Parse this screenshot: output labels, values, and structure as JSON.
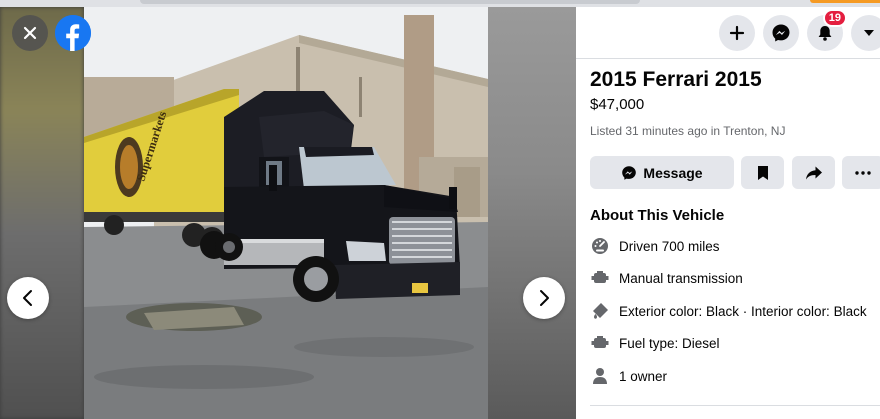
{
  "listing": {
    "title": "2015 Ferrari 2015",
    "price": "$47,000",
    "listed": "Listed 31 minutes ago in Trenton, NJ"
  },
  "topbar": {
    "notification_count": "19",
    "icons": [
      "plus-icon",
      "messenger-icon",
      "bell-icon",
      "caret-down-icon"
    ]
  },
  "actions": {
    "message_label": "Message",
    "icons": [
      "messenger-icon",
      "bookmark-icon",
      "share-icon",
      "more-icon"
    ]
  },
  "about": {
    "title": "About This Vehicle",
    "specs": [
      {
        "icon": "speedometer-icon",
        "text": "Driven 700 miles"
      },
      {
        "icon": "transmission-icon",
        "text": "Manual transmission"
      },
      {
        "icon": "paint-icon",
        "text": "Exterior color: Black · Interior color: Black"
      },
      {
        "icon": "engine-icon",
        "text": "Fuel type: Diesel"
      },
      {
        "icon": "person-icon",
        "text": "1 owner"
      }
    ]
  },
  "photo": {
    "trailer_text": "Supermarkets",
    "brand_color": "#1877f2",
    "badge_color": "#e41e3f"
  }
}
